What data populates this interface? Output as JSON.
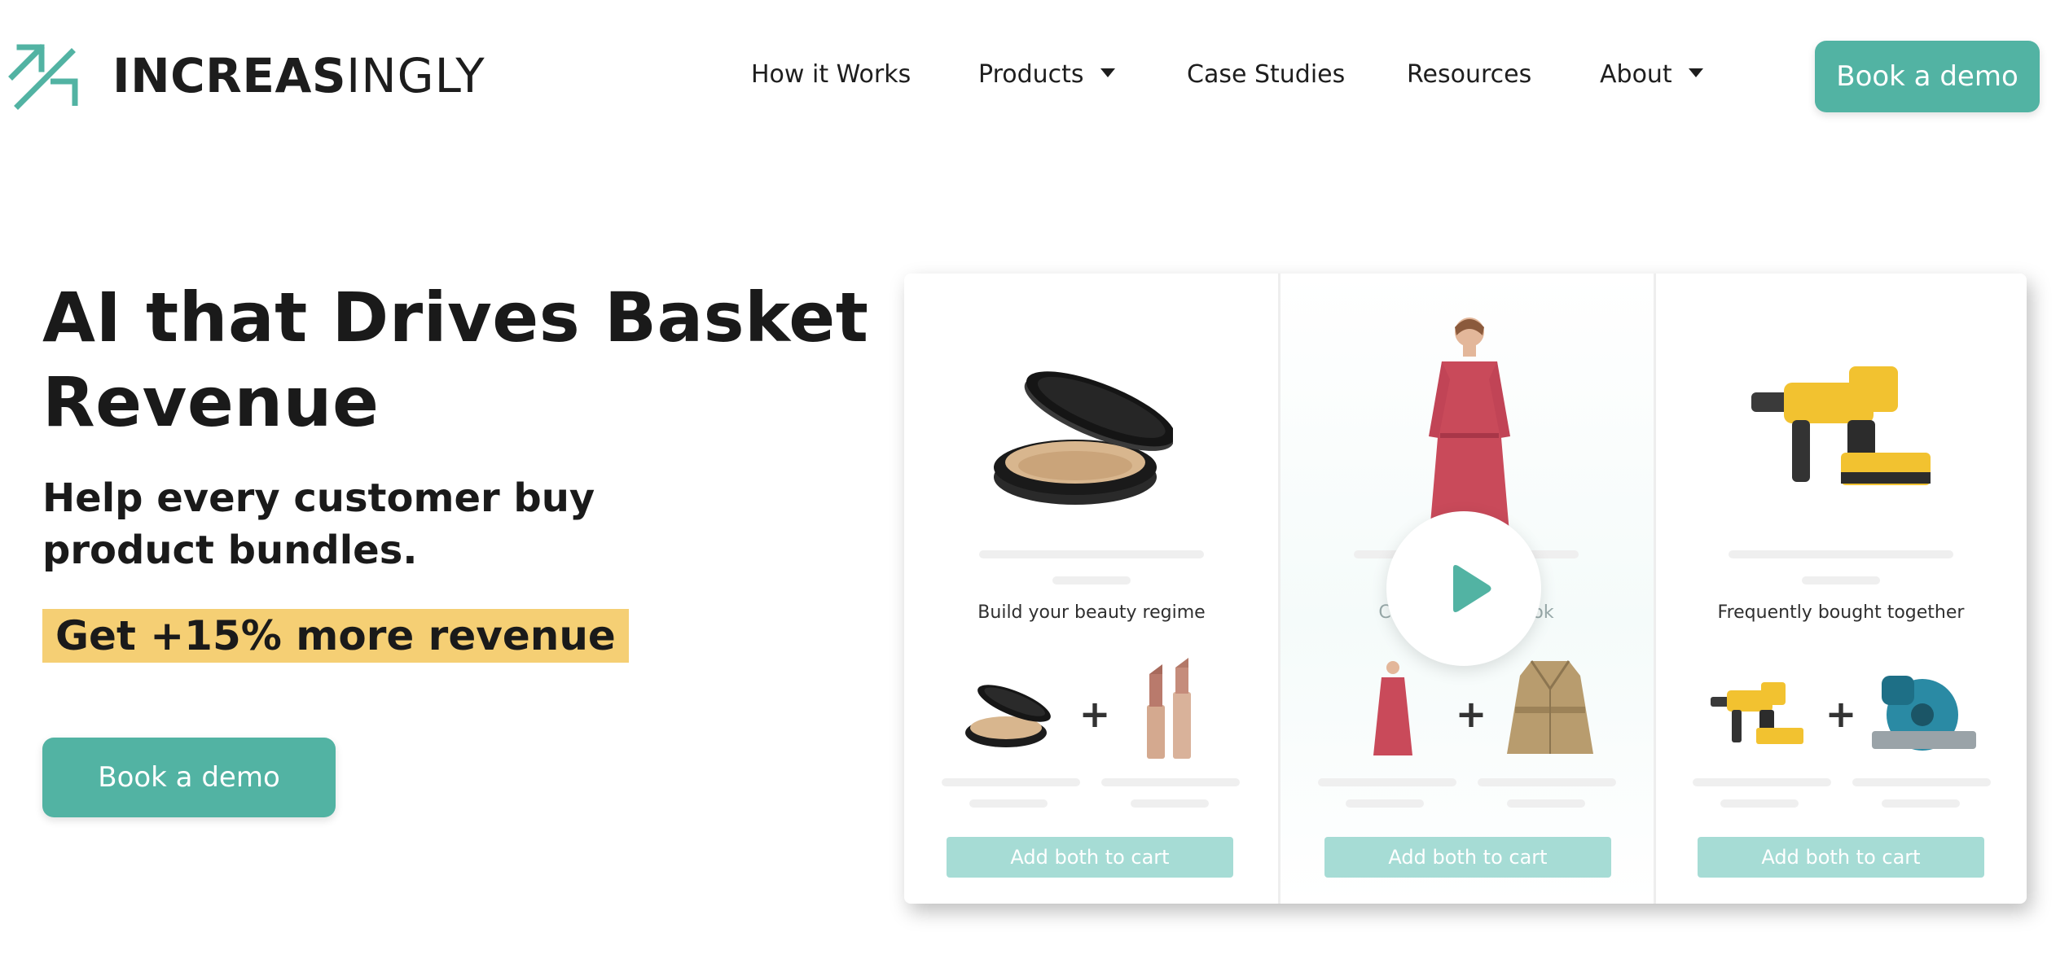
{
  "brand": {
    "bold": "INCREAS",
    "light": "INGLY",
    "accent_color": "#52b3a3"
  },
  "nav": {
    "items": [
      {
        "label": "How it Works",
        "has_dropdown": false
      },
      {
        "label": "Products",
        "has_dropdown": true
      },
      {
        "label": "Case Studies",
        "has_dropdown": false
      },
      {
        "label": "Resources",
        "has_dropdown": false
      },
      {
        "label": "About",
        "has_dropdown": true
      }
    ],
    "cta": "Book a demo"
  },
  "hero": {
    "title": "AI that Drives Basket Revenue",
    "subtitle": "Help every customer buy product bundles.",
    "highlight": "Get +15% more revenue",
    "highlight_color": "#f5cf74",
    "cta": "Book a demo"
  },
  "showcase": {
    "columns": [
      {
        "label": "Build your beauty regime",
        "main_product": "compact-powder",
        "bundle": [
          "compact-powder",
          "lipstick"
        ],
        "button": "Add both to cart"
      },
      {
        "label": "Complete your look",
        "main_product": "red-dress-model",
        "bundle": [
          "red-dress",
          "trench-coat"
        ],
        "button": "Add both to cart"
      },
      {
        "label": "Frequently bought together",
        "main_product": "yellow-hammer-drill",
        "bundle": [
          "hammer-drill",
          "circular-saw"
        ],
        "button": "Add both to cart"
      }
    ],
    "plus_symbol": "+",
    "play_icon": "play-icon",
    "button_color": "#a6dcd5"
  }
}
